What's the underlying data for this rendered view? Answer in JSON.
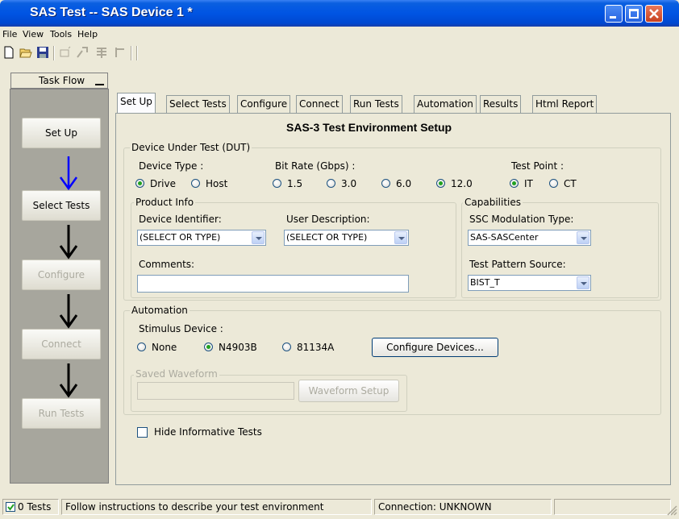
{
  "window": {
    "title": "SAS Test -- SAS Device 1 *"
  },
  "menu": [
    "File",
    "View",
    "Tools",
    "Help"
  ],
  "taskflow": {
    "title": "Task Flow",
    "steps": [
      "Set Up",
      "Select Tests",
      "Configure",
      "Connect",
      "Run Tests"
    ]
  },
  "tabs": [
    "Set Up",
    "Select Tests",
    "Configure",
    "Connect",
    "Run Tests",
    "Automation",
    "Results",
    "Html Report"
  ],
  "setup": {
    "heading": "SAS-3 Test Environment Setup",
    "dut": {
      "group": "Device Under Test (DUT)",
      "device_type_label": "Device Type :",
      "device_types": [
        "Drive",
        "Host"
      ],
      "device_type_selected": "Drive",
      "bitrate_label": "Bit Rate (Gbps) :",
      "bitrates": [
        "1.5",
        "3.0",
        "6.0",
        "12.0"
      ],
      "bitrate_selected": "12.0",
      "testpoint_label": "Test Point :",
      "testpoints": [
        "IT",
        "CT"
      ],
      "testpoint_selected": "IT"
    },
    "product": {
      "group": "Product Info",
      "device_id_label": "Device Identifier:",
      "device_id_value": "(SELECT OR TYPE)",
      "user_desc_label": "User Description:",
      "user_desc_value": "(SELECT OR TYPE)",
      "comments_label": "Comments:",
      "comments_value": ""
    },
    "capabilities": {
      "group": "Capabilities",
      "ssc_label": "SSC Modulation Type:",
      "ssc_value": "SAS-SASCenter",
      "pattern_label": "Test Pattern Source:",
      "pattern_value": "BIST_T"
    },
    "automation": {
      "group": "Automation",
      "stimulus_label": "Stimulus Device :",
      "stimulus_options": [
        "None",
        "N4903B",
        "81134A"
      ],
      "stimulus_selected": "N4903B",
      "configure_button": "Configure Devices...",
      "saved_waveform_group": "Saved Waveform",
      "waveform_setup_button": "Waveform Setup"
    },
    "hide_informative_label": "Hide Informative Tests",
    "hide_informative_checked": false
  },
  "status": {
    "tests": "0 Tests",
    "tests_checked": true,
    "message": "Follow instructions to describe your test environment",
    "connection": "Connection: UNKNOWN"
  }
}
